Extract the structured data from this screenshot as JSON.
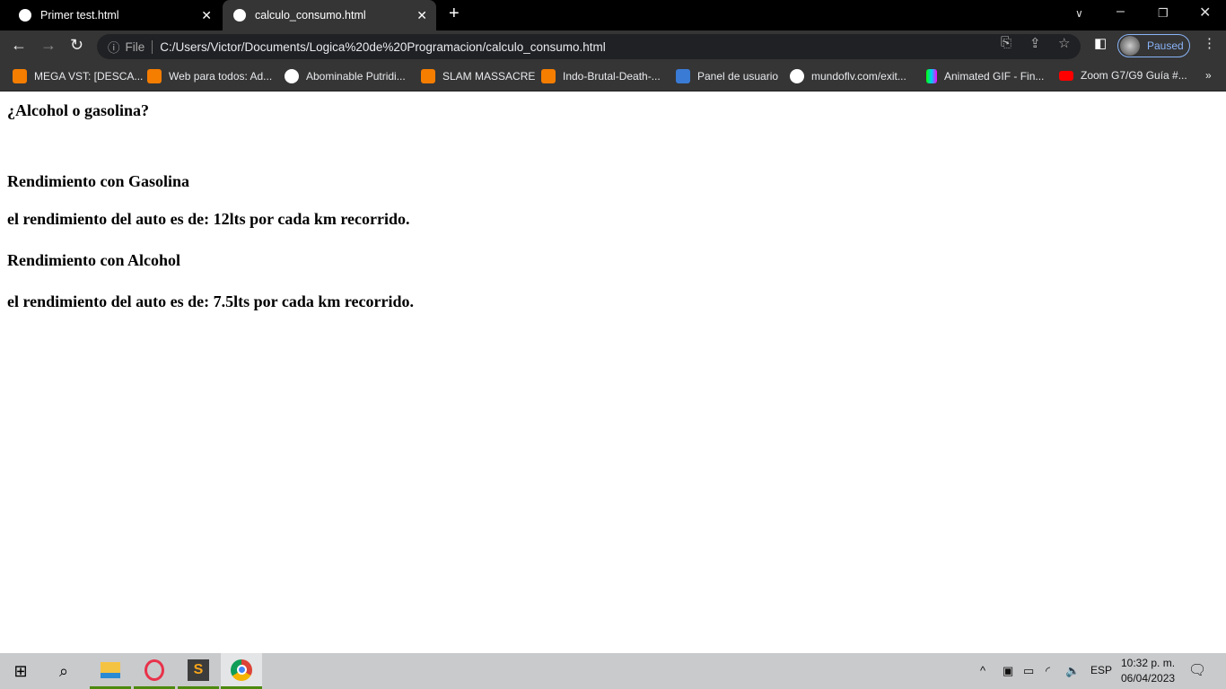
{
  "browser": {
    "tabs": [
      {
        "title": "Primer test.html",
        "active": false
      },
      {
        "title": "calculo_consumo.html",
        "active": true
      }
    ],
    "address": {
      "scheme_label": "File",
      "url": "C:/Users/Victor/Documents/Logica%20de%20Programacion/calculo_consumo.html"
    },
    "profile_status": "Paused",
    "bookmarks": [
      {
        "label": "MEGA VST: [DESCA...",
        "icon": "blogger-icon"
      },
      {
        "label": "Web para todos: Ad...",
        "icon": "blogger-icon"
      },
      {
        "label": "Abominable Putridi...",
        "icon": "globe-icon"
      },
      {
        "label": "SLAM MASSACRE",
        "icon": "blogger-icon"
      },
      {
        "label": "Indo-Brutal-Death-...",
        "icon": "blogger-icon"
      },
      {
        "label": "Panel de usuario",
        "icon": "tt-icon"
      },
      {
        "label": "mundoflv.com/exit...",
        "icon": "globe-icon"
      },
      {
        "label": "Animated GIF - Fin...",
        "icon": "giphy-icon"
      },
      {
        "label": "Zoom G7/G9 Guía #...",
        "icon": "youtube-icon"
      }
    ]
  },
  "page": {
    "title": "¿Alcohol o gasolina?",
    "gas_heading": "Rendimiento con Gasolina",
    "gas_result": "el rendimiento del auto es de: 12lts por cada km recorrido.",
    "alcohol_heading": "Rendimiento con Alcohol",
    "alcohol_result": "el rendimiento del auto es de: 7.5lts por cada km recorrido."
  },
  "taskbar": {
    "language": "ESP",
    "time": "10:32 p. m.",
    "date": "06/04/2023"
  },
  "colors": {
    "blogger": "#f57d00",
    "youtube": "#ff0000",
    "taskbar_running": "#4c8a0f"
  }
}
